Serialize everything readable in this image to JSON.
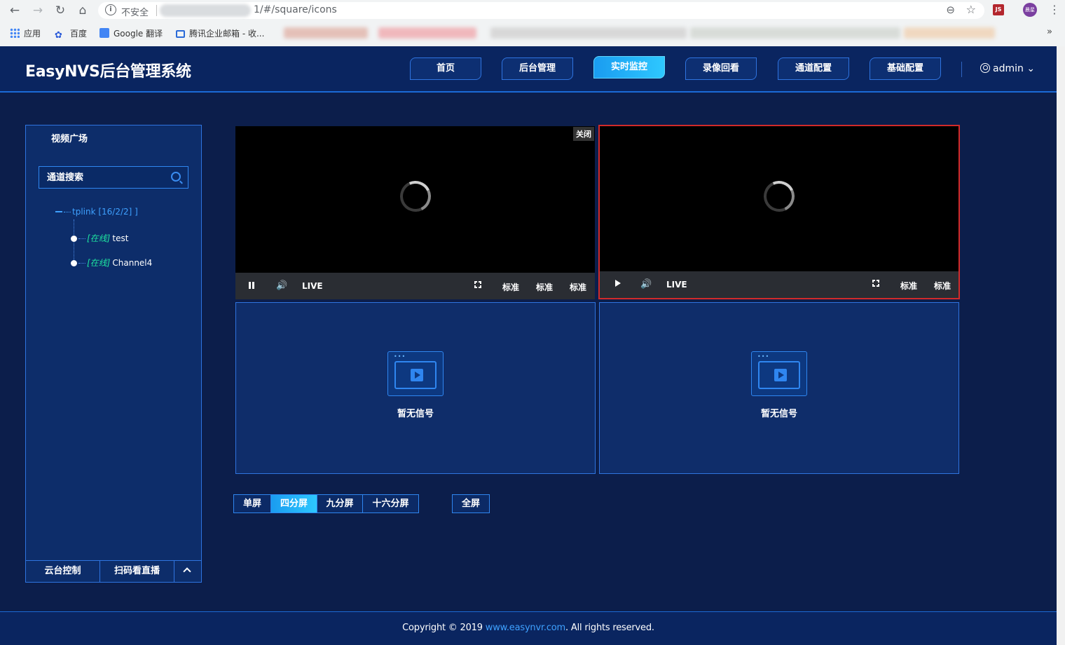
{
  "browser": {
    "security_label": "不安全",
    "url_visible": "1/#/square/icons",
    "bookmarks": [
      {
        "label": "应用"
      },
      {
        "label": "百度"
      },
      {
        "label": "Google 翻译"
      },
      {
        "label": "腾讯企业邮箱 - 收..."
      }
    ],
    "extension_label": "JS",
    "profile_label": "晨星",
    "bookmarks_more": "»"
  },
  "header": {
    "title": "EasyNVS后台管理系统",
    "tabs": [
      {
        "label": "首页",
        "active": false
      },
      {
        "label": "后台管理",
        "active": false
      },
      {
        "label": "实时监控",
        "active": true
      },
      {
        "label": "录像回看",
        "active": false
      },
      {
        "label": "通道配置",
        "active": false
      },
      {
        "label": "基础配置",
        "active": false
      }
    ],
    "user": "admin",
    "user_caret": "⌄"
  },
  "sidebar": {
    "title": "视频广场",
    "search_placeholder": "通道搜索",
    "tree": {
      "root_label": "tplink [16/2/2] ]",
      "items": [
        {
          "status": "[在线]",
          "name": "test"
        },
        {
          "status": "[在线]",
          "name": "Channel4"
        }
      ]
    },
    "bottom": {
      "ptz": "云台控制",
      "scan": "扫码看直播"
    }
  },
  "players": [
    {
      "close_label": "关闭",
      "live": "LIVE",
      "quality": [
        "标准",
        "标准",
        "标准"
      ]
    },
    {
      "live": "LIVE",
      "quality": [
        "标准",
        "标准"
      ]
    }
  ],
  "empty_slots": [
    {
      "text": "暂无信号"
    },
    {
      "text": "暂无信号"
    }
  ],
  "layout": {
    "buttons": [
      {
        "label": "单屏",
        "active": false
      },
      {
        "label": "四分屏",
        "active": true
      },
      {
        "label": "九分屏",
        "active": false
      },
      {
        "label": "十六分屏",
        "active": false
      }
    ],
    "fullscreen": "全屏"
  },
  "footer": {
    "prefix": "Copyright © 2019 ",
    "link": "www.easynvr.com",
    "suffix": ". All rights reserved."
  },
  "colors": {
    "accent": "#2ec8ff",
    "border": "#2f74e0",
    "online": "#1ee3a0",
    "selected_border": "#d22a2a"
  }
}
